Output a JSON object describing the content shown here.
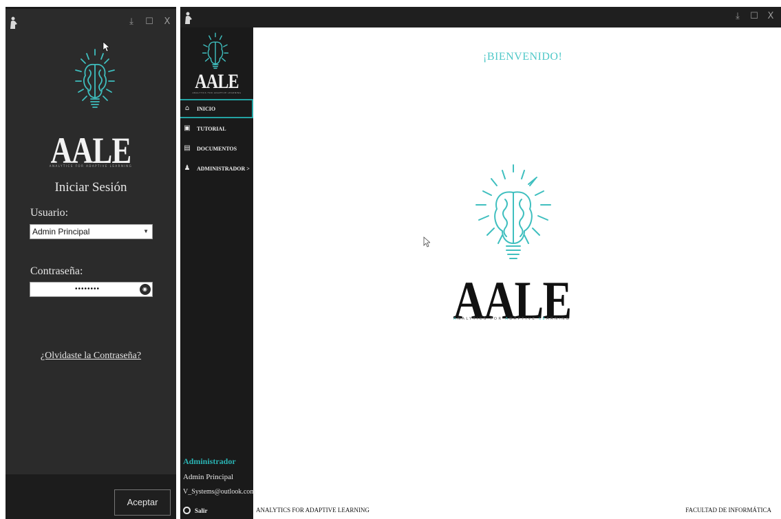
{
  "colors": {
    "accent": "#3fbfbf",
    "dark_bg": "#2b2b2b",
    "sidebar_bg": "#1a1a1a"
  },
  "login": {
    "brand": "AALE",
    "tagline": "ANALYTICS FOR ADAPTIVE LEARNING",
    "title": "Iniciar Sesión",
    "user_label": "Usuario:",
    "user_value": "Admin Principal",
    "password_label": "Contraseña:",
    "password_value": "••••••••",
    "forgot_link": "¿Olvidaste la Contraseña?",
    "accept_button": "Aceptar",
    "window_buttons": [
      "⤓",
      "☐",
      "X"
    ]
  },
  "main": {
    "window_buttons": [
      "⤓",
      "☐",
      "X"
    ],
    "sidebar": {
      "brand": "AALE",
      "tagline": "ANALYTICS FOR ADAPTIVE LEARNING",
      "items": [
        {
          "label": "INICIO",
          "icon": "home-icon"
        },
        {
          "label": "TUTORIAL",
          "icon": "tutorial-icon"
        },
        {
          "label": "DOCUMENTOS",
          "icon": "documents-icon"
        },
        {
          "label": "ADMINISTRADOR  >",
          "icon": "admin-icon"
        }
      ],
      "active_item": "INICIO",
      "user": {
        "role": "Administrador",
        "name": "Admin Principal",
        "email": "V_Systems@outlook.com"
      },
      "logout_label": "Salir"
    },
    "content": {
      "welcome": "¡BIENVENIDO!",
      "brand": "AALE",
      "tagline_parts": [
        "A",
        "NALYTICS FOR ",
        "A",
        "DAPTIVE ",
        "LE",
        "ARNING"
      ]
    },
    "status_left": "ANALYTICS FOR ADAPTIVE LEARNING",
    "status_right": "FACULTAD DE INFORMÁTICA"
  }
}
